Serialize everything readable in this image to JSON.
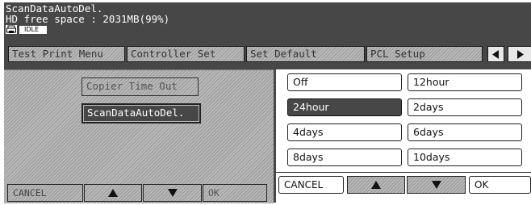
{
  "status": {
    "line1": "ScanDataAutoDel.",
    "line2": "HD free space : 2031MB(99%)",
    "state": "IDLE"
  },
  "tabs": [
    {
      "label": "Test Print Menu"
    },
    {
      "label": "Controller Set"
    },
    {
      "label": "Set Default"
    },
    {
      "label": "PCL Setup"
    }
  ],
  "nav": {
    "prev_icon": "left-arrow-icon",
    "next_icon": "right-arrow-icon"
  },
  "menu": {
    "copier_timeout": "Copier Time Out",
    "scan_data_auto_del": "ScanDataAutoDel."
  },
  "left_footer": {
    "cancel": "CANCEL",
    "ok": "OK"
  },
  "options": [
    {
      "label": "Off",
      "selected": false
    },
    {
      "label": "12hour",
      "selected": false
    },
    {
      "label": "24hour",
      "selected": true
    },
    {
      "label": "2days",
      "selected": false
    },
    {
      "label": "4days",
      "selected": false
    },
    {
      "label": "6days",
      "selected": false
    },
    {
      "label": "8days",
      "selected": false
    },
    {
      "label": "10days",
      "selected": false
    }
  ],
  "right_footer": {
    "cancel": "CANCEL",
    "ok": "OK"
  },
  "colors": {
    "screen_dark": "#474747",
    "panel_hatch": "#b9b9b9",
    "selected": "#474747"
  }
}
